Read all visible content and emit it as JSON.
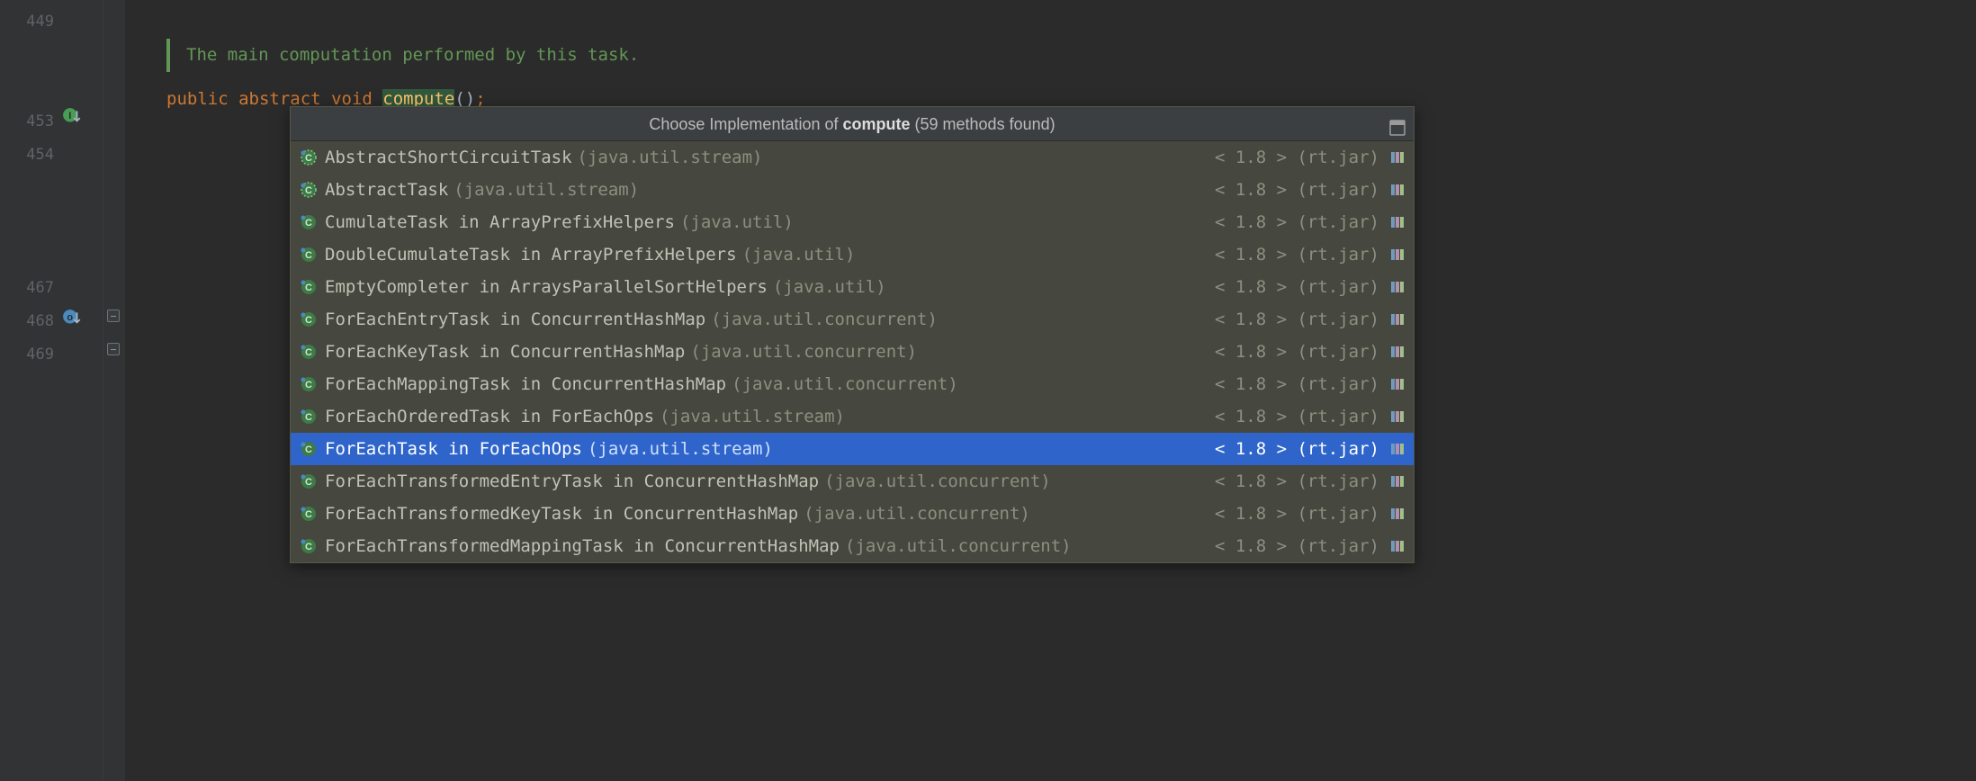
{
  "lineNumbers": [
    "449",
    "",
    "",
    "453",
    "454",
    "",
    "",
    "",
    "467",
    "468",
    "469"
  ],
  "javadoc": "The main computation performed by this task.",
  "code": {
    "kw_public": "public",
    "kw_abstract": "abstract",
    "kw_void": "void",
    "method_name": "compute",
    "parens": "()",
    "semi": ";"
  },
  "popup": {
    "title_prefix": "Choose Implementation of ",
    "title_target": "compute",
    "title_suffix": " (59 methods found)",
    "items": [
      {
        "name": "AbstractShortCircuitTask",
        "in": "",
        "pkg": "(java.util.stream)",
        "location": "< 1.8 > (rt.jar)",
        "selected": false,
        "abstract": true
      },
      {
        "name": "AbstractTask",
        "in": "",
        "pkg": "(java.util.stream)",
        "location": "< 1.8 > (rt.jar)",
        "selected": false,
        "abstract": true
      },
      {
        "name": "CumulateTask",
        "in": "in ArrayPrefixHelpers",
        "pkg": "(java.util)",
        "location": "< 1.8 > (rt.jar)",
        "selected": false,
        "abstract": false
      },
      {
        "name": "DoubleCumulateTask",
        "in": "in ArrayPrefixHelpers",
        "pkg": "(java.util)",
        "location": "< 1.8 > (rt.jar)",
        "selected": false,
        "abstract": false
      },
      {
        "name": "EmptyCompleter",
        "in": "in ArraysParallelSortHelpers",
        "pkg": "(java.util)",
        "location": "< 1.8 > (rt.jar)",
        "selected": false,
        "abstract": false
      },
      {
        "name": "ForEachEntryTask",
        "in": "in ConcurrentHashMap",
        "pkg": "(java.util.concurrent)",
        "location": "< 1.8 > (rt.jar)",
        "selected": false,
        "abstract": false
      },
      {
        "name": "ForEachKeyTask",
        "in": "in ConcurrentHashMap",
        "pkg": "(java.util.concurrent)",
        "location": "< 1.8 > (rt.jar)",
        "selected": false,
        "abstract": false
      },
      {
        "name": "ForEachMappingTask",
        "in": "in ConcurrentHashMap",
        "pkg": "(java.util.concurrent)",
        "location": "< 1.8 > (rt.jar)",
        "selected": false,
        "abstract": false
      },
      {
        "name": "ForEachOrderedTask",
        "in": "in ForEachOps",
        "pkg": "(java.util.stream)",
        "location": "< 1.8 > (rt.jar)",
        "selected": false,
        "abstract": false
      },
      {
        "name": "ForEachTask",
        "in": "in ForEachOps",
        "pkg": "(java.util.stream)",
        "location": "< 1.8 > (rt.jar)",
        "selected": true,
        "abstract": false
      },
      {
        "name": "ForEachTransformedEntryTask",
        "in": "in ConcurrentHashMap",
        "pkg": "(java.util.concurrent)",
        "location": "< 1.8 > (rt.jar)",
        "selected": false,
        "abstract": false
      },
      {
        "name": "ForEachTransformedKeyTask",
        "in": "in ConcurrentHashMap",
        "pkg": "(java.util.concurrent)",
        "location": "< 1.8 > (rt.jar)",
        "selected": false,
        "abstract": false
      },
      {
        "name": "ForEachTransformedMappingTask",
        "in": "in ConcurrentHashMap",
        "pkg": "(java.util.concurrent)",
        "location": "< 1.8 > (rt.jar)",
        "selected": false,
        "abstract": false
      }
    ]
  }
}
